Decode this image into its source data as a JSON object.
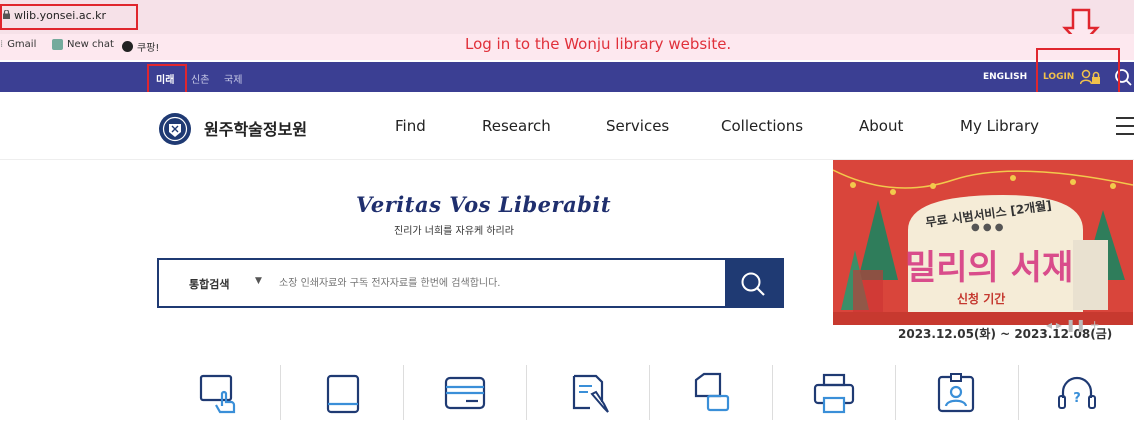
{
  "browser": {
    "url": "wlib.yonsei.ac.kr",
    "bookmarks": [
      "Gmail",
      "New chat",
      "쿠팡!"
    ]
  },
  "instruction": "Log in to the Wonju library website.",
  "topbar": {
    "campuses": [
      "미래",
      "신촌",
      "국제"
    ],
    "english": "ENGLISH",
    "login": "LOGIN"
  },
  "header": {
    "logo_text": "원주학술정보원",
    "menu": [
      "Find",
      "Research",
      "Services",
      "Collections",
      "About",
      "My Library"
    ]
  },
  "hero": {
    "motto": "Veritas Vos Liberabit",
    "motto_sub": "진리가 너희를 자유케 하리라"
  },
  "search": {
    "scope": "통합검색",
    "placeholder": "소장 인쇄자료와 구독 전자자료를 한번에 검색합니다."
  },
  "banner": {
    "title_small": "무료 시범서비스 [2개월]",
    "title_big": "밀리의 서재",
    "label": "신청 기간",
    "date": "2023.12.05(화) ~ 2023.12.08(금)"
  },
  "quick_icons": [
    "touch-screen-icon",
    "book-icon",
    "card-icon",
    "document-edit-icon",
    "copy-device-icon",
    "printer-icon",
    "id-badge-icon",
    "help-headset-icon"
  ]
}
